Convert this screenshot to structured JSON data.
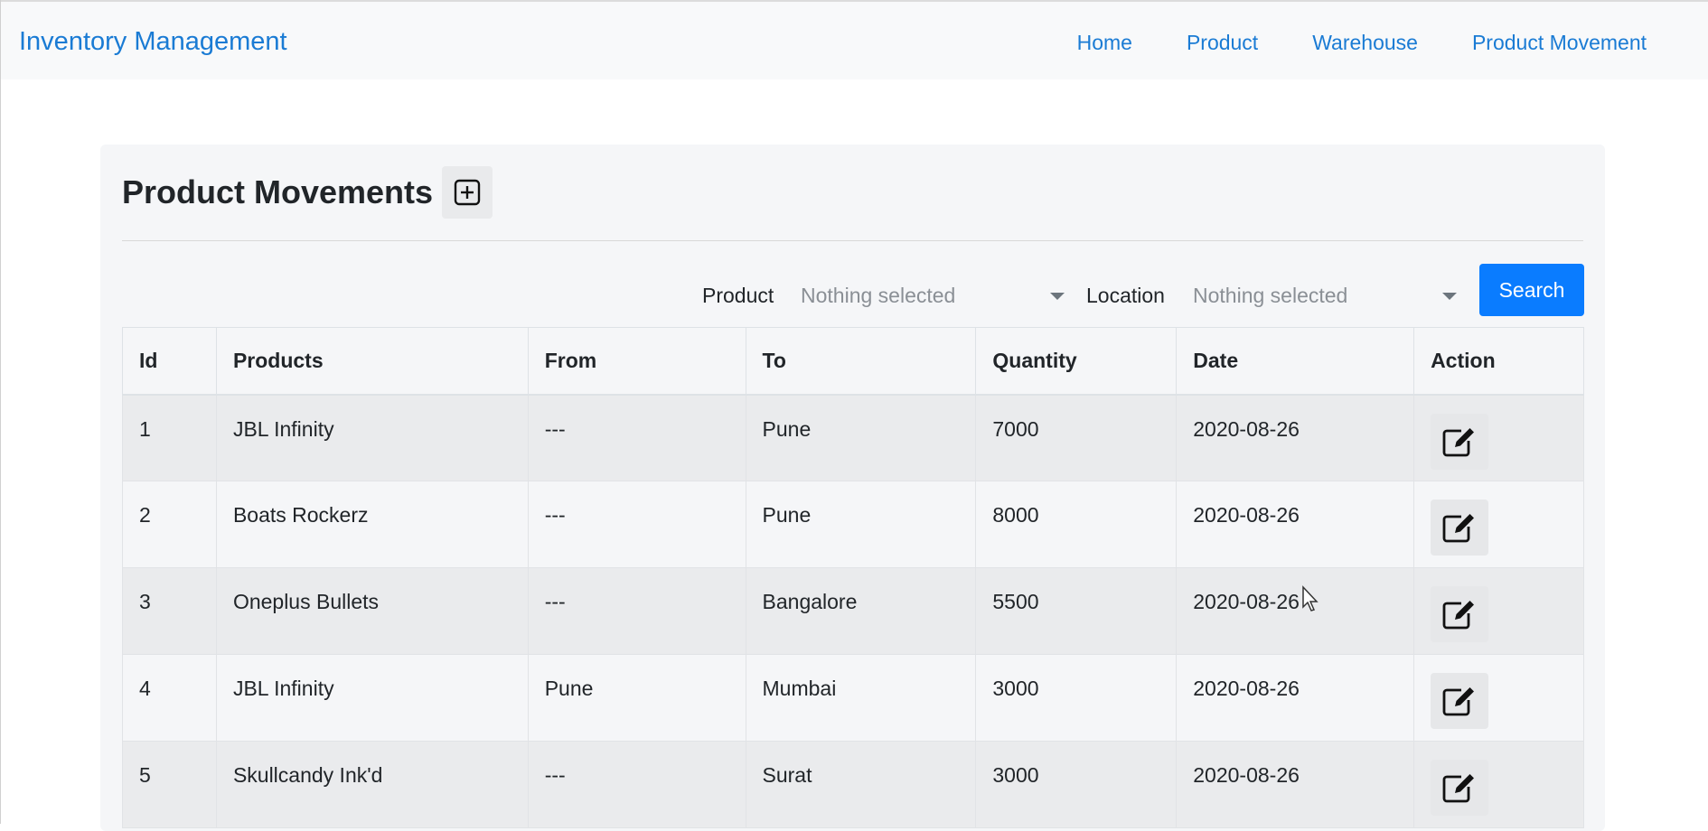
{
  "navbar": {
    "brand": "Inventory Management",
    "links": [
      "Home",
      "Product",
      "Warehouse",
      "Product Movement"
    ]
  },
  "page": {
    "title": "Product Movements",
    "add_icon": "plus-square-icon"
  },
  "filters": {
    "product_label": "Product",
    "product_value": "Nothing selected",
    "location_label": "Location",
    "location_value": "Nothing selected",
    "search_label": "Search"
  },
  "table": {
    "headers": [
      "Id",
      "Products",
      "From",
      "To",
      "Quantity",
      "Date",
      "Action"
    ],
    "rows": [
      {
        "id": "1",
        "product": "JBL Infinity",
        "from": "---",
        "to": "Pune",
        "quantity": "7000",
        "date": "2020-08-26"
      },
      {
        "id": "2",
        "product": "Boats Rockerz",
        "from": "---",
        "to": "Pune",
        "quantity": "8000",
        "date": "2020-08-26"
      },
      {
        "id": "3",
        "product": "Oneplus Bullets",
        "from": "---",
        "to": "Bangalore",
        "quantity": "5500",
        "date": "2020-08-26"
      },
      {
        "id": "4",
        "product": "JBL Infinity",
        "from": "Pune",
        "to": "Mumbai",
        "quantity": "3000",
        "date": "2020-08-26"
      },
      {
        "id": "5",
        "product": "Skullcandy Ink'd",
        "from": "---",
        "to": "Surat",
        "quantity": "3000",
        "date": "2020-08-26"
      }
    ],
    "action_icon": "edit-icon"
  },
  "colors": {
    "link": "#1a7bd4",
    "primary_button": "#0a7cff",
    "navbar_bg": "#f8f9fa",
    "card_bg": "#f5f6f8"
  }
}
